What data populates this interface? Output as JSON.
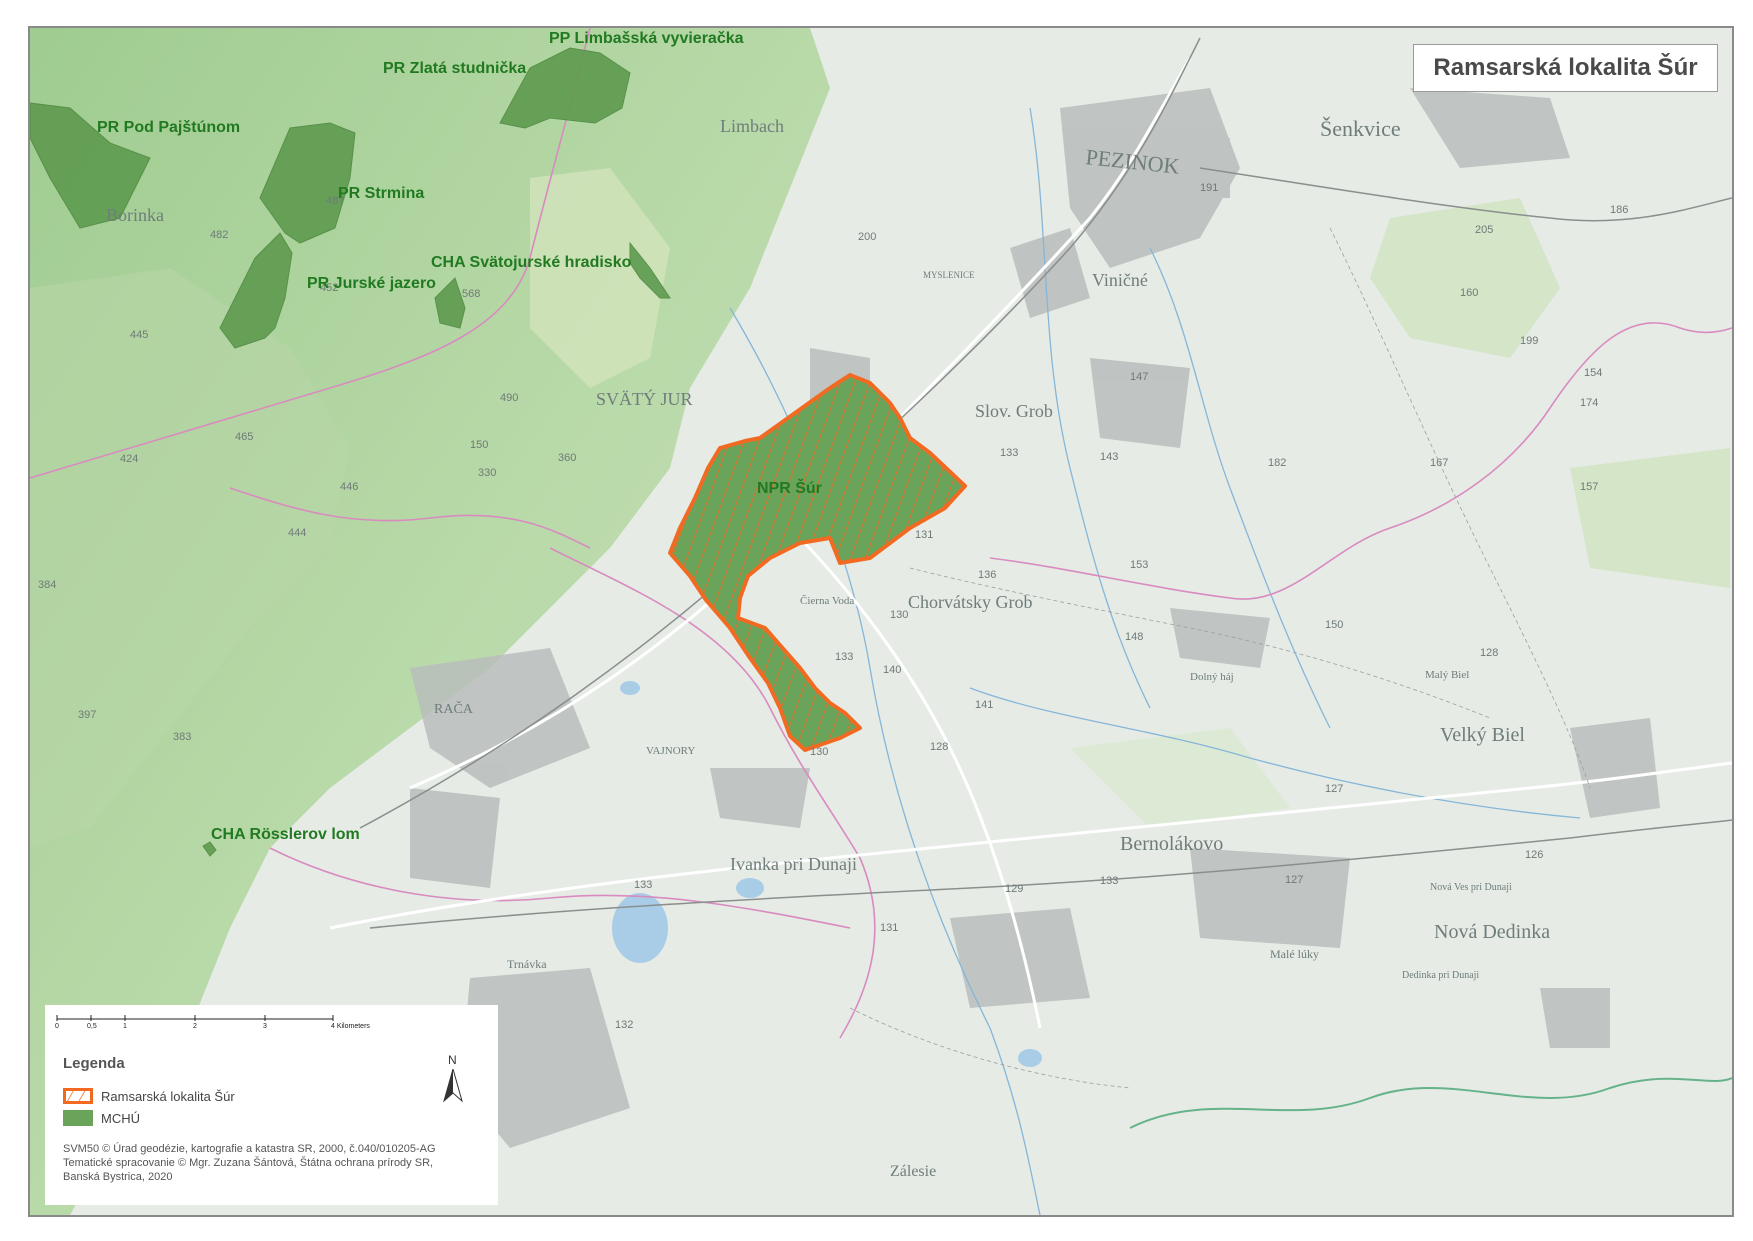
{
  "map": {
    "title": "Ramsarská lokalita Šúr",
    "protected_areas": [
      {
        "name": "PP Limbašská vyvieračka"
      },
      {
        "name": "PR Zlatá studnička"
      },
      {
        "name": "PR Pod Pajštúnom"
      },
      {
        "name": "PR Strmina"
      },
      {
        "name": "CHA Svätojurské hradisko"
      },
      {
        "name": "PR Jurské jazero"
      },
      {
        "name": "NPR Šúr"
      },
      {
        "name": "CHA Rösslerov lom"
      }
    ],
    "places": [
      "PEZINOK",
      "Limbach",
      "Šenkvice",
      "Viničné",
      "Slov. Grob",
      "SVÄTÝ JUR",
      "Chorvátsky Grob",
      "RAČA",
      "VAJNORY",
      "Ivanka pri Dunaji",
      "Bernolákovo",
      "Velký Biel",
      "Malý Biel",
      "Nová Dedinka",
      "Borinka",
      "Čierna Voda",
      "MYSLENICE",
      "Zálesie",
      "Nová Ves pri Dunaji",
      "Dedinka pri Dunaji",
      "Trnávka",
      "Malé lúky",
      "Dolný háj"
    ],
    "spot_heights": [
      "191",
      "200",
      "205",
      "186",
      "160",
      "199",
      "174",
      "154",
      "147",
      "133",
      "143",
      "182",
      "167",
      "157",
      "131",
      "136",
      "130",
      "133",
      "140",
      "141",
      "153",
      "148",
      "150",
      "128",
      "128",
      "130",
      "127",
      "126",
      "129",
      "131",
      "133",
      "132",
      "127",
      "133",
      "487",
      "482",
      "452",
      "445",
      "465",
      "424",
      "446",
      "444",
      "490",
      "568",
      "360",
      "330",
      "384",
      "397",
      "383",
      "150"
    ]
  },
  "legend": {
    "scale_ticks": [
      "0",
      "0,5",
      "1",
      "2",
      "3",
      "4 Kilometers"
    ],
    "title": "Legenda",
    "items": [
      {
        "label": "Ramsarská lokalita Šúr",
        "fill": "#6aa35a",
        "stroke": "#f26a21"
      },
      {
        "label": "MCHÚ",
        "fill": "#6aa35a",
        "stroke": "#6aa35a"
      }
    ],
    "north": "N",
    "credits": [
      "SVM50 © Úrad geodézie, kartografie a katastra SR, 2000, č.040/010205-AG",
      "Tematické spracovanie © Mgr. Zuzana Šántová, Štátna ochrana prírody SR,",
      "Banská Bystrica, 2020"
    ]
  },
  "colors": {
    "ramsar_outline": "#f26a21",
    "mchu_fill": "#5e9b4f",
    "hills": "#a9cf9a",
    "roads": "#ffffff",
    "boundary": "#d98bc0",
    "water": "#7fb7dd"
  }
}
